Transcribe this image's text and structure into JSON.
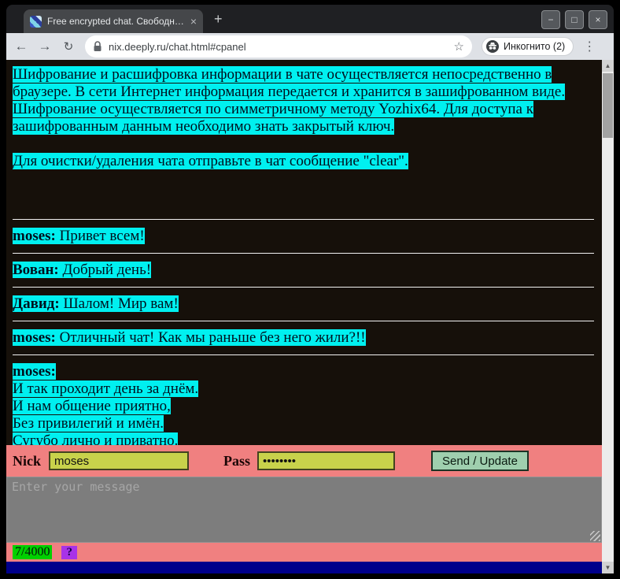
{
  "window": {
    "minimize": "−",
    "maximize": "□",
    "close": "×"
  },
  "browser": {
    "tab_title": "Free encrypted chat. Свободны...",
    "tab_close": "×",
    "new_tab": "+",
    "back": "←",
    "forward": "→",
    "reload": "↻",
    "url": "nix.deeply.ru/chat.html#cpanel",
    "bookmark_star": "☆",
    "incognito_label": "Инкогнито (2)",
    "menu": "⋮"
  },
  "scrollbar": {
    "up": "▲",
    "down": "▼"
  },
  "chat": {
    "intro": [
      "Шифрование и расшифровка информации в чате осуществляется непосредственно в браузере. В сети Интернет информация передается и хранится в зашифрованном виде. Шифрование осуществляется по симметричному методу Yozhix64. Для доступа к зашифрованным данным необходимо знать закрытый ключ.",
      "Для очистки/удаления чата отправьте в чат сообщение \"clear\"."
    ],
    "messages": [
      {
        "nick": "moses:",
        "text": "Привет всем!"
      },
      {
        "nick": "Вован:",
        "text": "Добрый день!"
      },
      {
        "nick": "Давид:",
        "text": "Шалом! Мир вам!"
      },
      {
        "nick": "moses:",
        "text": "Отличный чат! Как мы раньше без него жили?!!"
      },
      {
        "nick": "moses:",
        "lines": [
          "И так проходит день за днём.",
          "И нам общение приятно,",
          "Без привилегий и имён.",
          "Сугубо лично и приватно."
        ]
      }
    ]
  },
  "panel": {
    "nick_label": "Nick",
    "nick_value": "moses",
    "pass_label": "Pass",
    "pass_value": "••••••••",
    "send_label": "Send / Update",
    "message_placeholder": "Enter your message",
    "counter": "7/4000",
    "help": "?"
  },
  "colors": {
    "highlight": "#00f0f0",
    "panel_bg": "#f08080",
    "input_bg": "#c8d24b",
    "button_bg": "#9fcfae",
    "counter_bg": "#00d000",
    "help_bg": "#a832e8",
    "footer_bg": "#00008b"
  }
}
